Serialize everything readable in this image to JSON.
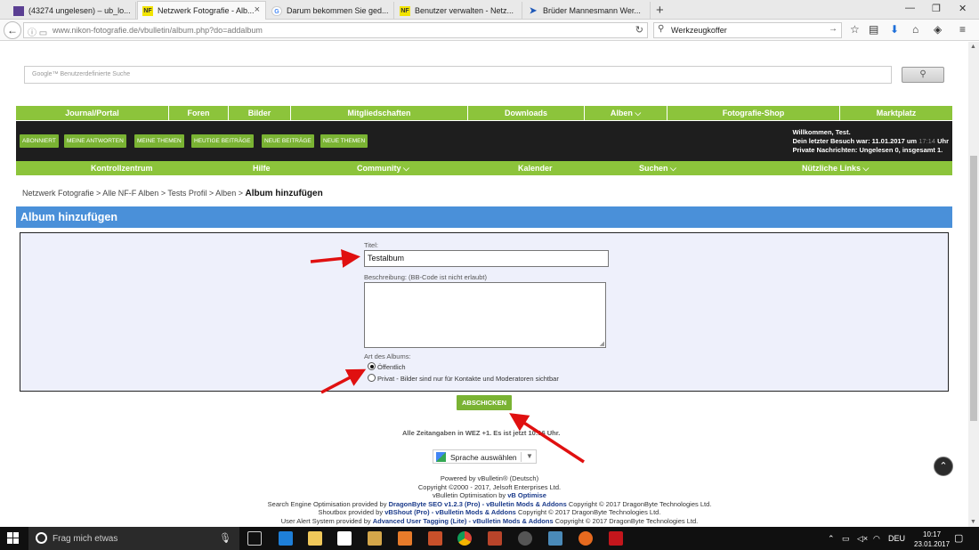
{
  "browser": {
    "tabs": [
      {
        "label": "(43274 ungelesen) – ub_lo...",
        "favicon": "mail-icon"
      },
      {
        "label": "Netzwerk Fotografie - Alb...",
        "favicon": "NF"
      },
      {
        "label": "Darum bekommen Sie ged...",
        "favicon": "G"
      },
      {
        "label": "Benutzer verwalten - Netz...",
        "favicon": "NF"
      },
      {
        "label": "Brüder Mannesmann Wer...",
        "favicon": "bm-icon"
      }
    ],
    "url": "www.nikon-fotografie.de/vbulletin/album.php?do=addalbum",
    "search_value": "Werkzeugkoffer"
  },
  "google_search": {
    "placeholder": "Google™ Benutzerdefinierte Suche"
  },
  "main_menu": [
    "Journal/Portal",
    "Foren",
    "Bilder",
    "Mitgliedschaften",
    "Downloads",
    "Alben",
    "Fotografie-Shop",
    "Marktplatz"
  ],
  "quick_buttons": [
    "ABONNIERT",
    "MEINE ANTWORTEN",
    "MEINE THEMEN",
    "HEUTIGE BEITRÄGE",
    "NEUE BEITRÄGE",
    "NEUE THEMEN"
  ],
  "welcome": {
    "line1": "Willkommen, Test.",
    "line2_a": "Dein letzter Besuch war: 11.01.2017 um",
    "line2_time": "17:14",
    "line2_b": "Uhr",
    "line3": "Private Nachrichten: Ungelesen 0, insgesamt 1."
  },
  "sub_menu": [
    "Kontrollzentrum",
    "Hilfe",
    "Community",
    "Kalender",
    "Suchen",
    "Nützliche Links"
  ],
  "breadcrumb": {
    "path": "Netzwerk Fotografie > Alle NF-F Alben > Tests Profil > Alben >",
    "current": "Album hinzufügen"
  },
  "section_title": "Album hinzufügen",
  "form": {
    "title_label": "Titel:",
    "title_value": "Testalbum",
    "description_label": "Beschreibung: (BB-Code ist nicht erlaubt)",
    "type_label": "Art des Albums:",
    "option_public": "Öffentlich",
    "option_private": "Privat - Bilder sind nur für Kontakte und Moderatoren sichtbar",
    "submit": "ABSCHICKEN"
  },
  "timezone_note": "Alle Zeitangaben in WEZ +1. Es ist jetzt 10:16 Uhr.",
  "language_select": "Sprache auswählen",
  "footer": {
    "line1_a": "Powered by",
    "line1_b": "vBulletin® (Deutsch)",
    "line2": "Copyright ©2000 - 2017, Jelsoft Enterprises Ltd.",
    "line3_a": "vBulletin Optimisation by",
    "line3_b": "vB Optimise",
    "line4_a": "Search Engine Optimisation provided by",
    "line4_b": "DragonByte SEO v1.2.3 (Pro) - vBulletin Mods & Addons",
    "line4_c": "Copyright © 2017 DragonByte Technologies Ltd.",
    "line5_a": "Shoutbox provided by",
    "line5_b": "vBShout (Pro) - vBulletin Mods & Addons",
    "line5_c": "Copyright © 2017 DragonByte Technologies Ltd.",
    "line6_a": "User Alert System provided by",
    "line6_b": "Advanced User Tagging (Lite) - vBulletin Mods & Addons",
    "line6_c": "Copyright © 2017 DragonByte Technologies Ltd."
  },
  "taskbar": {
    "search_placeholder": "Frag mich etwas",
    "language": "DEU",
    "time": "10:17",
    "date": "23.01.2017"
  },
  "colors": {
    "menu_green": "#8cc43b",
    "header_blue": "#4a90d9",
    "form_bg": "#eef0fb",
    "arrow_red": "#e01010"
  }
}
